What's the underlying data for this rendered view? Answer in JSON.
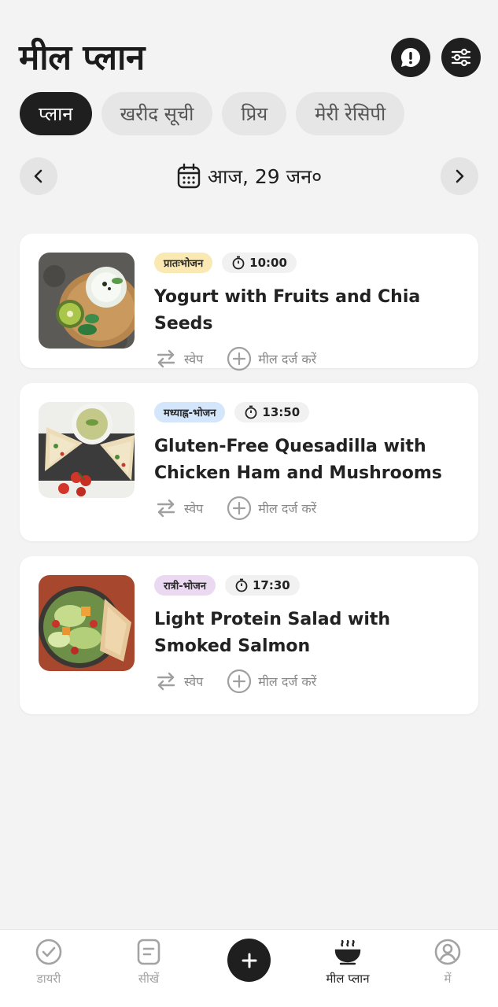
{
  "header": {
    "title": "मील प्लान"
  },
  "tabs": [
    {
      "label": "प्लान"
    },
    {
      "label": "खरीद सूची"
    },
    {
      "label": "प्रिय"
    },
    {
      "label": "मेरी रेसिपी"
    }
  ],
  "date": {
    "label": "आज, 29 जन०"
  },
  "meals": [
    {
      "type": "प्रातःभोजन",
      "type_color": "#fbe9b3",
      "time": "10:00",
      "title": "Yogurt with Fruits and Chia Seeds",
      "swap": "स्वेप",
      "log": "मील दर्ज करें"
    },
    {
      "type": "मध्याह्न-भोजन",
      "type_color": "#d4e6fb",
      "time": "13:50",
      "title": "Gluten-Free Quesadilla with Chicken Ham and Mushrooms",
      "swap": "स्वेप",
      "log": "मील दर्ज करें"
    },
    {
      "type": "रात्री-भोजन",
      "type_color": "#ead9f0",
      "time": "17:30",
      "title": "Light Protein Salad with Smoked Salmon",
      "swap": "स्वेप",
      "log": "मील दर्ज करें"
    }
  ],
  "bottom_nav": {
    "diary": "डायरी",
    "learn": "सीखें",
    "meal_plan": "मील प्लान",
    "me": "में"
  }
}
